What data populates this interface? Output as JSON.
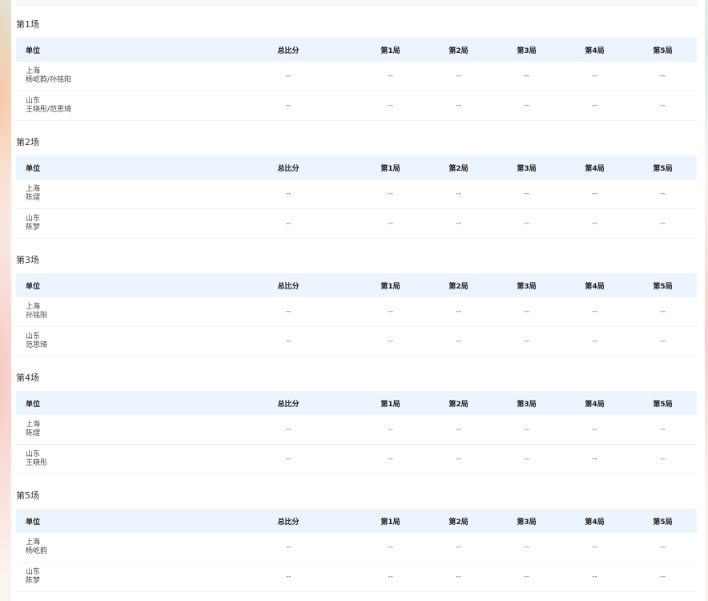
{
  "header": {
    "unit": "单位",
    "total": "总比分",
    "games": [
      "第1局",
      "第2局",
      "第3局",
      "第4局",
      "第5局"
    ]
  },
  "matches": [
    {
      "title": "第1场",
      "rows": [
        {
          "city": "上海",
          "players": "杨屹韵/孙铭阳",
          "total": "--",
          "games": [
            "--",
            "--",
            "--",
            "--",
            "--"
          ]
        },
        {
          "city": "山东",
          "players": "王晓彤/范思琦",
          "total": "--",
          "games": [
            "--",
            "--",
            "--",
            "--",
            "--"
          ]
        }
      ]
    },
    {
      "title": "第2场",
      "rows": [
        {
          "city": "上海",
          "players": "陈熠",
          "total": "--",
          "games": [
            "--",
            "--",
            "--",
            "--",
            "--"
          ]
        },
        {
          "city": "山东",
          "players": "陈梦",
          "total": "--",
          "games": [
            "--",
            "--",
            "--",
            "--",
            "--"
          ]
        }
      ]
    },
    {
      "title": "第3场",
      "rows": [
        {
          "city": "上海",
          "players": "孙铭阳",
          "total": "--",
          "games": [
            "--",
            "--",
            "--",
            "--",
            "--"
          ]
        },
        {
          "city": "山东",
          "players": "范思琦",
          "total": "--",
          "games": [
            "--",
            "--",
            "--",
            "--",
            "--"
          ]
        }
      ]
    },
    {
      "title": "第4场",
      "rows": [
        {
          "city": "上海",
          "players": "陈熠",
          "total": "--",
          "games": [
            "--",
            "--",
            "--",
            "--",
            "--"
          ]
        },
        {
          "city": "山东",
          "players": "王晓彤",
          "total": "--",
          "games": [
            "--",
            "--",
            "--",
            "--",
            "--"
          ]
        }
      ]
    },
    {
      "title": "第5场",
      "rows": [
        {
          "city": "上海",
          "players": "杨屹韵",
          "total": "--",
          "games": [
            "--",
            "--",
            "--",
            "--",
            "--"
          ]
        },
        {
          "city": "山东",
          "players": "陈梦",
          "total": "--",
          "games": [
            "--",
            "--",
            "--",
            "--",
            "--"
          ]
        }
      ]
    }
  ]
}
